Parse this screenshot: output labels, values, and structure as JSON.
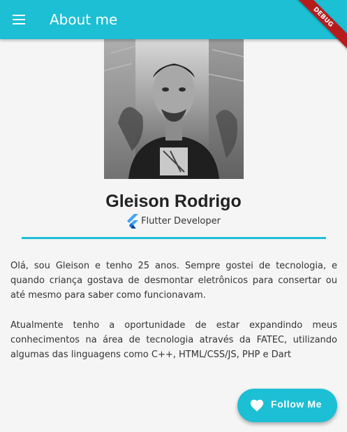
{
  "app_bar": {
    "title": "About me",
    "menu_icon": "menu-icon",
    "background_color": "#1cbfd4"
  },
  "debug_banner": {
    "label": "DEBUG",
    "color": "#b71c1c"
  },
  "profile": {
    "photo_alt": "profile-photo",
    "name": "Gleison Rodrigo",
    "role": "Flutter Developer",
    "role_icon": "flutter-logo-icon"
  },
  "bio": {
    "paragraphs": [
      "Olá, sou Gleison e tenho 25 anos. Sempre gostei de tecnologia, e quando criança gostava de desmontar eletrônicos para consertar ou até mesmo para saber como funcionavam.",
      "Atualmente tenho a oportunidade de estar expandindo meus conhecimentos na área de tecnologia através da FATEC, utilizando algumas das linguagens como C++, HTML/CSS/JS, PHP e Dart"
    ]
  },
  "fab": {
    "label": "Follow Me",
    "icon": "heart-icon"
  },
  "colors": {
    "accent": "#1cbfd4",
    "background": "#f5f5f5",
    "text": "#333333"
  }
}
